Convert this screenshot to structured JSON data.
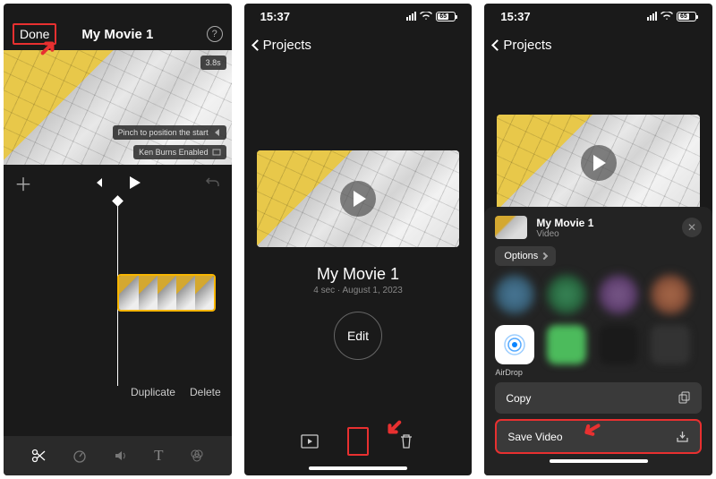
{
  "panel1": {
    "done": "Done",
    "title": "My Movie 1",
    "duration": "3.8s",
    "pinch": "Pinch to position the start",
    "kenburns": "Ken Burns Enabled",
    "duplicate": "Duplicate",
    "delete": "Delete"
  },
  "panel2": {
    "time": "15:37",
    "battery": "65",
    "back": "Projects",
    "title": "My Movie 1",
    "meta": "4 sec · August 1, 2023",
    "edit": "Edit"
  },
  "panel3": {
    "time": "15:37",
    "battery": "65",
    "back": "Projects",
    "sheet_title": "My Movie 1",
    "sheet_sub": "Video",
    "options": "Options",
    "airdrop": "AirDrop",
    "copy": "Copy",
    "save": "Save Video"
  }
}
